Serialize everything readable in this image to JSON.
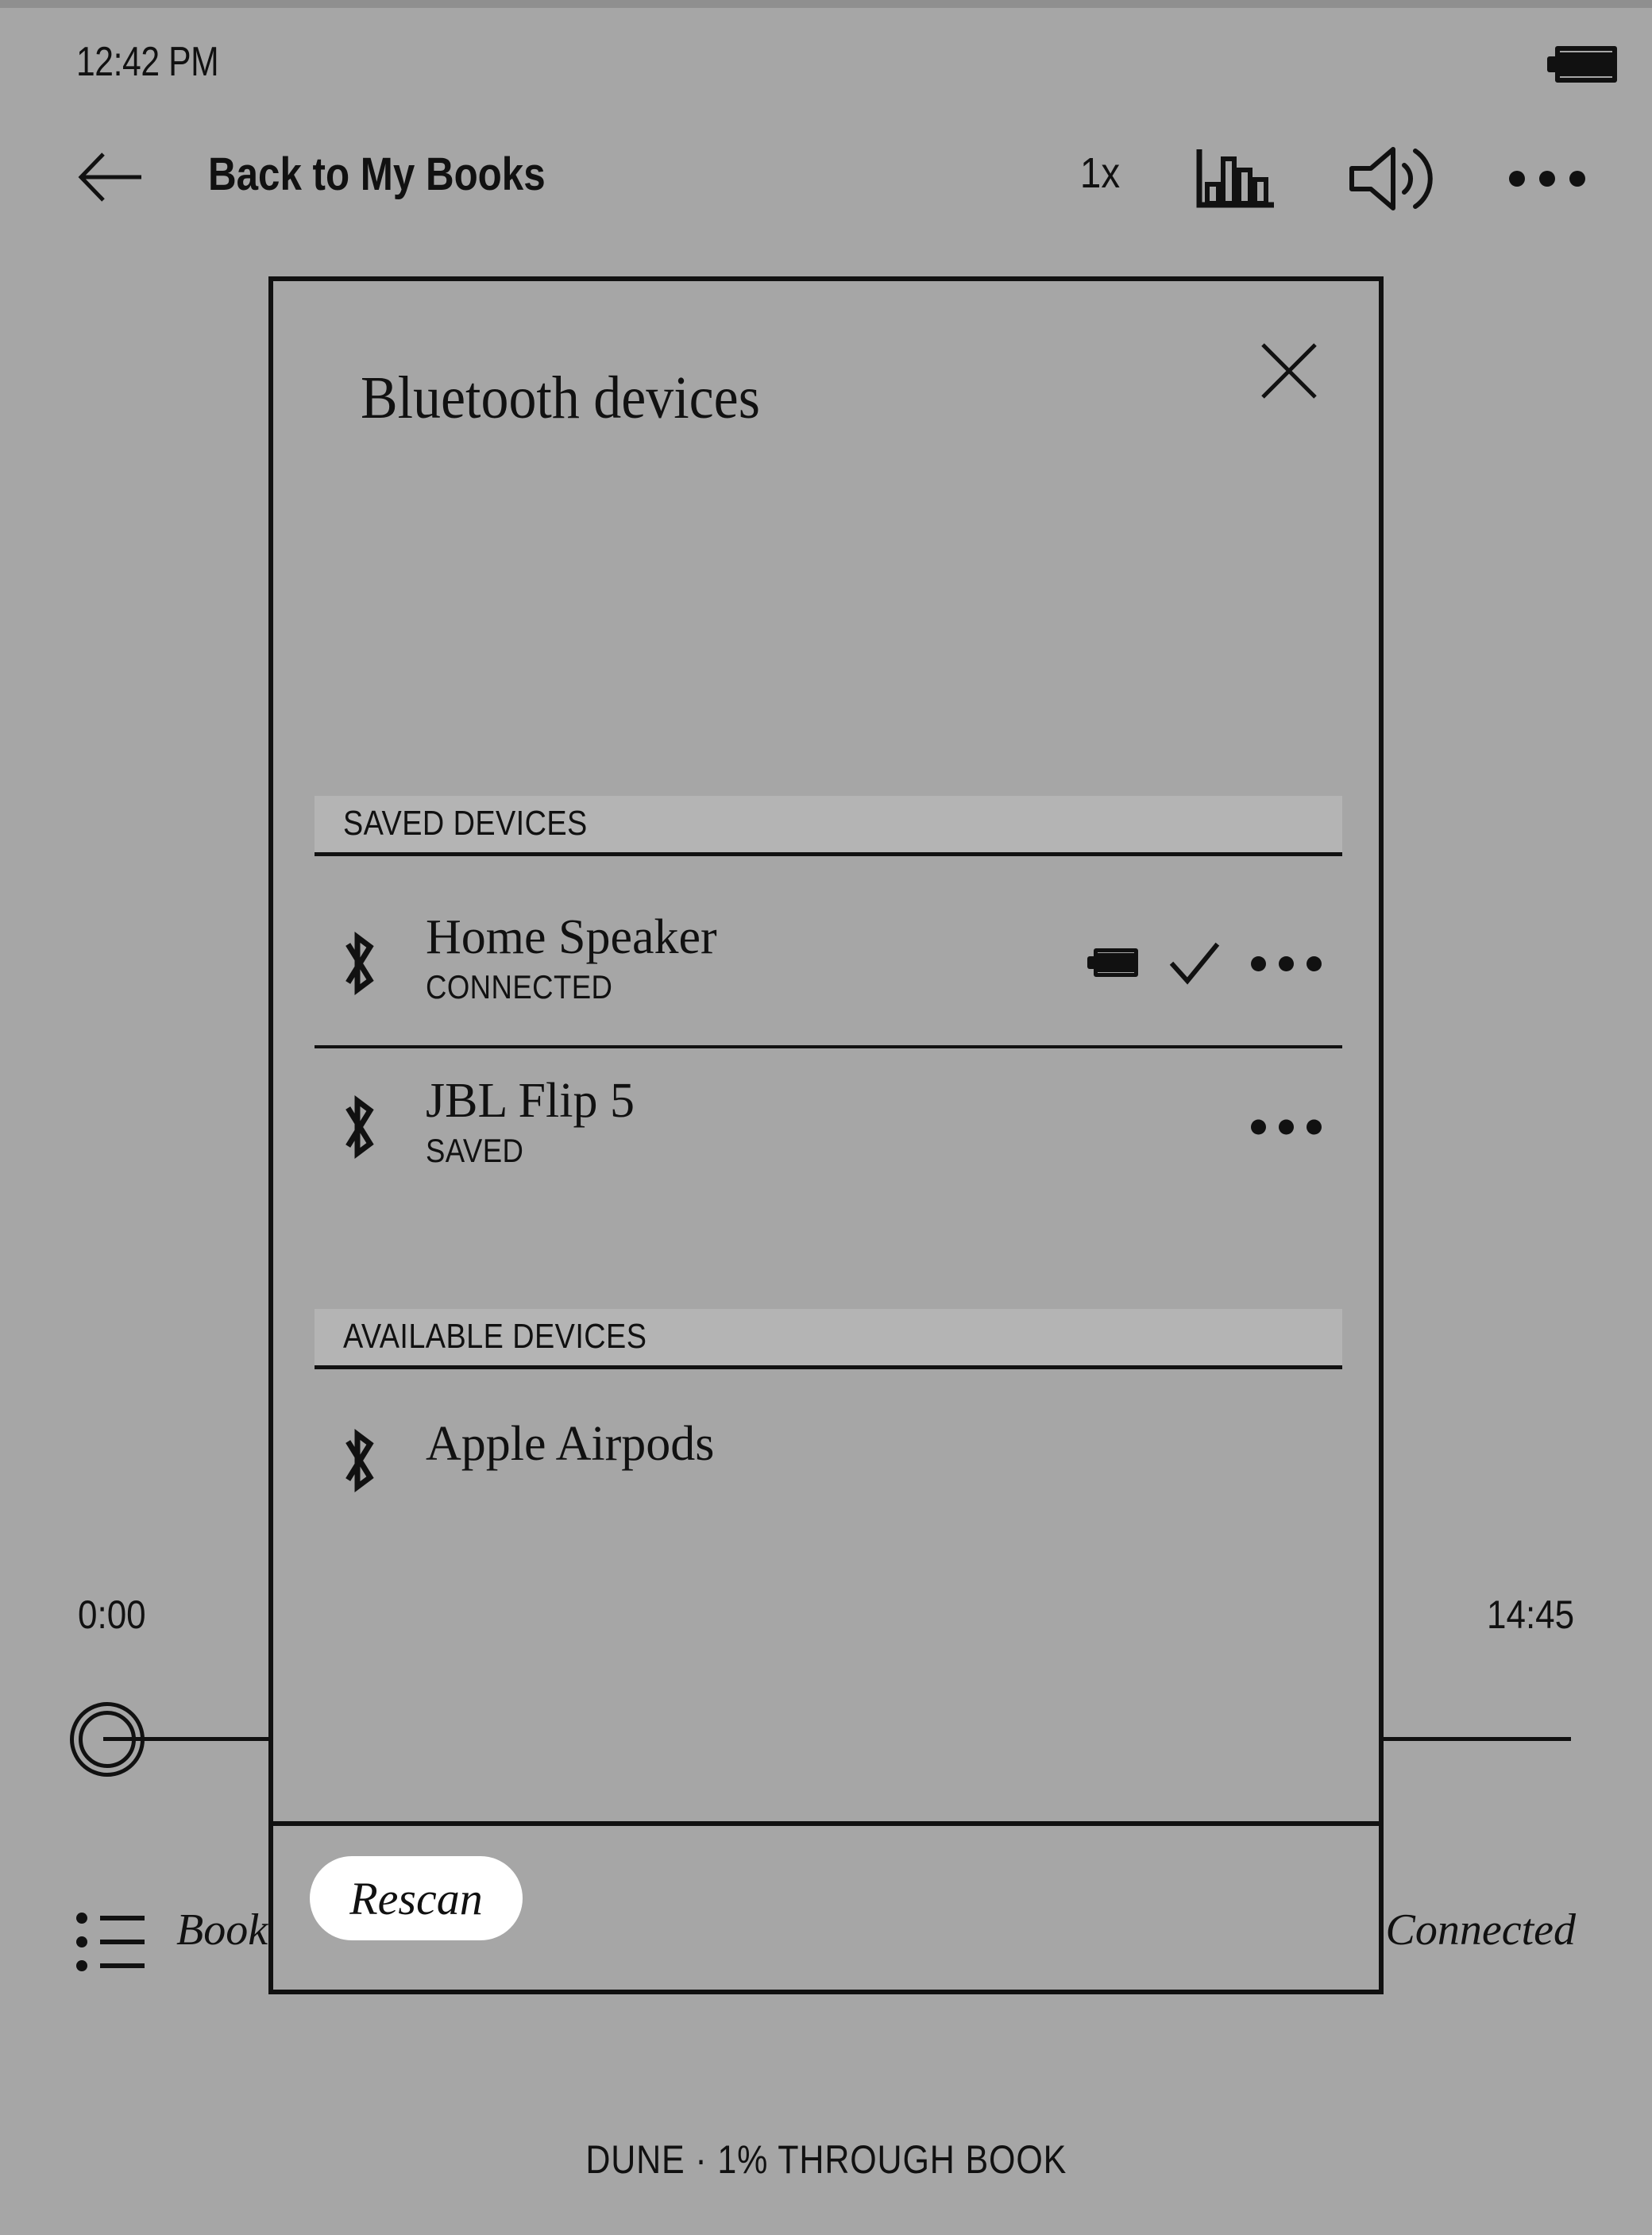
{
  "status_bar": {
    "time": "12:42 PM",
    "battery_icon": "battery-full-icon"
  },
  "header": {
    "back_icon": "arrow-left-icon",
    "title": "Back to My Books",
    "playback_speed": "1x",
    "equalizer_icon": "equalizer-icon",
    "volume_icon": "speaker-volume-icon",
    "overflow_icon": "more-horizontal-icon"
  },
  "player": {
    "elapsed_time": "0:00",
    "total_time": "14:45",
    "scrubber_icon": "scrubber-handle-icon",
    "chapters_icon": "chapter-list-icon",
    "chapters_label": "Bookmarks",
    "connection_label": "Connected",
    "footer_note": "DUNE · 1% THROUGH BOOK"
  },
  "dialog": {
    "title": "Bluetooth devices",
    "close_icon": "close-icon",
    "sections": [
      {
        "id": "saved",
        "heading": "SAVED DEVICES",
        "devices": [
          {
            "name": "Home Speaker",
            "status": "CONNECTED",
            "bt_icon": "bluetooth-icon",
            "battery_icon": "battery-full-icon",
            "check_icon": "checkmark-icon",
            "menu_icon": "more-horizontal-icon"
          },
          {
            "name": "JBL Flip 5",
            "status": "SAVED",
            "bt_icon": "bluetooth-icon",
            "menu_icon": "more-horizontal-icon"
          }
        ]
      },
      {
        "id": "available",
        "heading": "AVAILABLE DEVICES",
        "devices": [
          {
            "name": "Apple Airpods",
            "bt_icon": "bluetooth-icon"
          }
        ]
      }
    ],
    "rescan_label": "Rescan"
  },
  "colors": {
    "background": "#a6a6a6",
    "ink": "#111111",
    "band": "#b4b4b4",
    "button_bg": "#ffffff"
  }
}
